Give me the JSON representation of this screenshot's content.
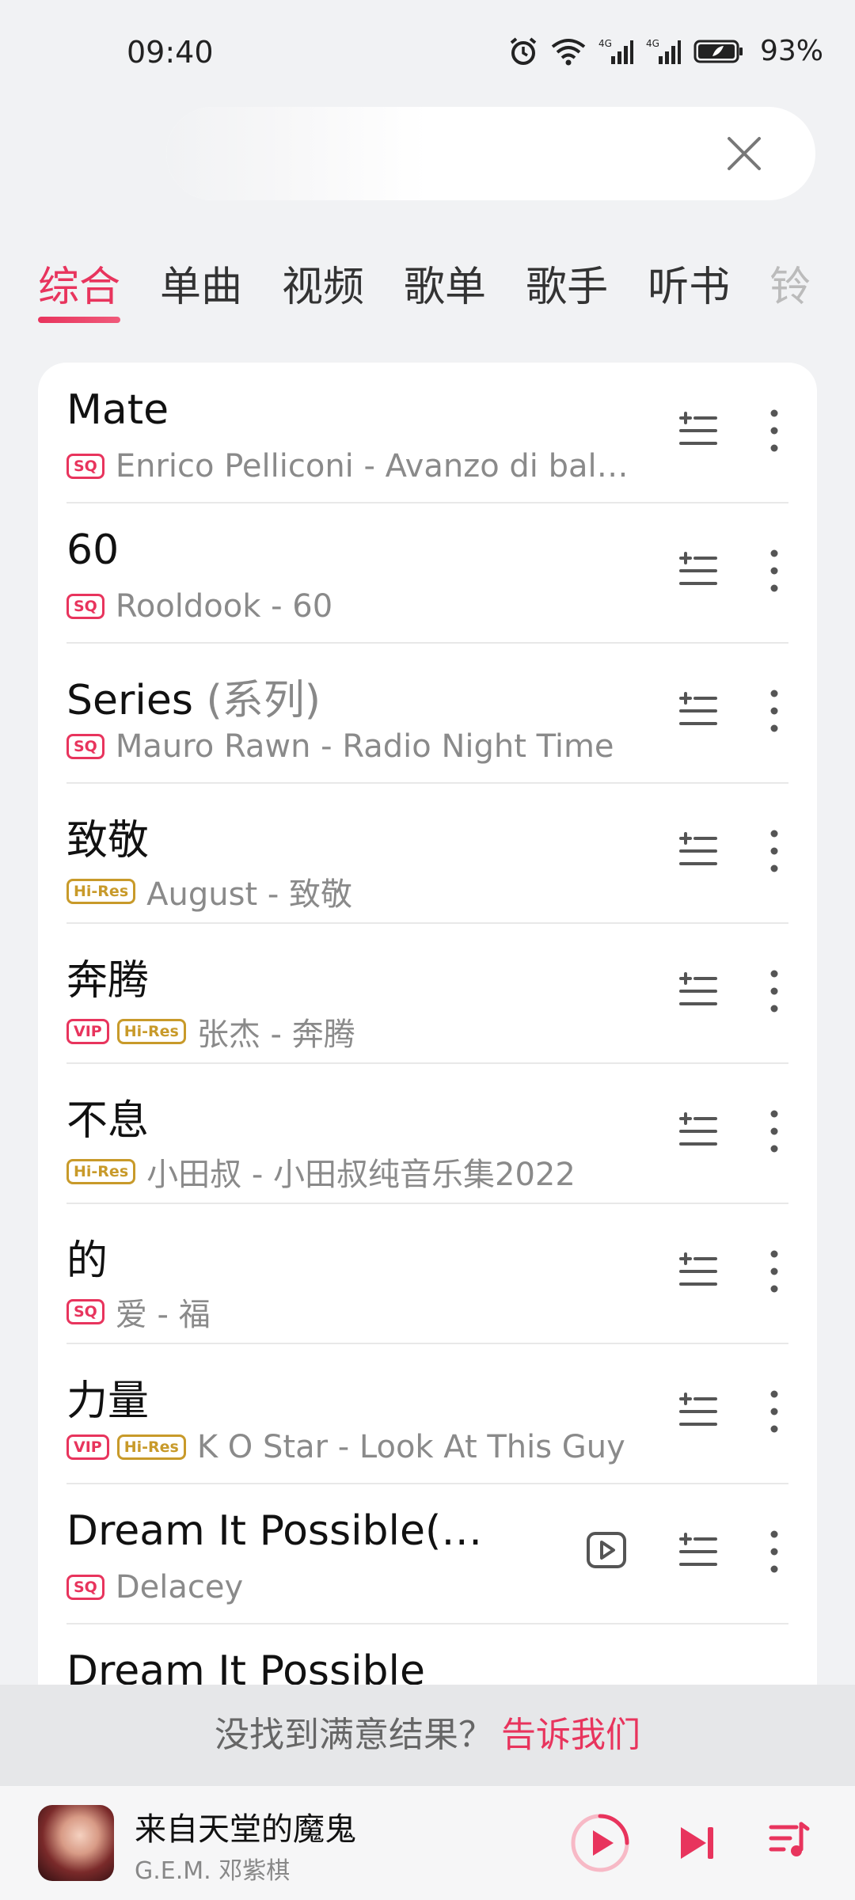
{
  "status": {
    "time": "09:40",
    "battery": "93%"
  },
  "tabs": [
    {
      "label": "综合"
    },
    {
      "label": "单曲"
    },
    {
      "label": "视频"
    },
    {
      "label": "歌单"
    },
    {
      "label": "歌手"
    },
    {
      "label": "听书"
    },
    {
      "label": "铃"
    }
  ],
  "songs": [
    {
      "title": "Mate",
      "title_sub": "",
      "artist": "Enrico Pelliconi - Avanzo di bal…"
    },
    {
      "title": "60",
      "title_sub": "",
      "artist": "Rooldook - 60"
    },
    {
      "title": "Series ",
      "title_sub": "(系列)",
      "artist": "Mauro Rawn - Radio Night Time"
    },
    {
      "title": "致敬",
      "title_sub": "",
      "artist": "August - 致敬"
    },
    {
      "title": "奔腾",
      "title_sub": "",
      "artist": "张杰 - 奔腾"
    },
    {
      "title": "不息",
      "title_sub": "",
      "artist": "小田叔 - 小田叔纯音乐集2022"
    },
    {
      "title": "的",
      "title_sub": "",
      "artist": "爱 - 福"
    },
    {
      "title": "力量",
      "title_sub": "",
      "artist": "K O Star - Look At This Guy"
    },
    {
      "title": "Dream It Possible(…",
      "title_sub": "",
      "artist": "Delacey"
    },
    {
      "title": "Dream It Possible",
      "title_sub": "",
      "artist": ""
    }
  ],
  "badges": {
    "sq": "SQ",
    "vip": "VIP",
    "hires": "Hi-Res"
  },
  "feedback": {
    "text": "没找到满意结果？",
    "link": "告诉我们"
  },
  "player": {
    "title": "来自天堂的魔鬼",
    "artist": "G.E.M. 邓紫棋"
  },
  "colors": {
    "accent": "#e8345d",
    "hires": "#c89a2a"
  }
}
